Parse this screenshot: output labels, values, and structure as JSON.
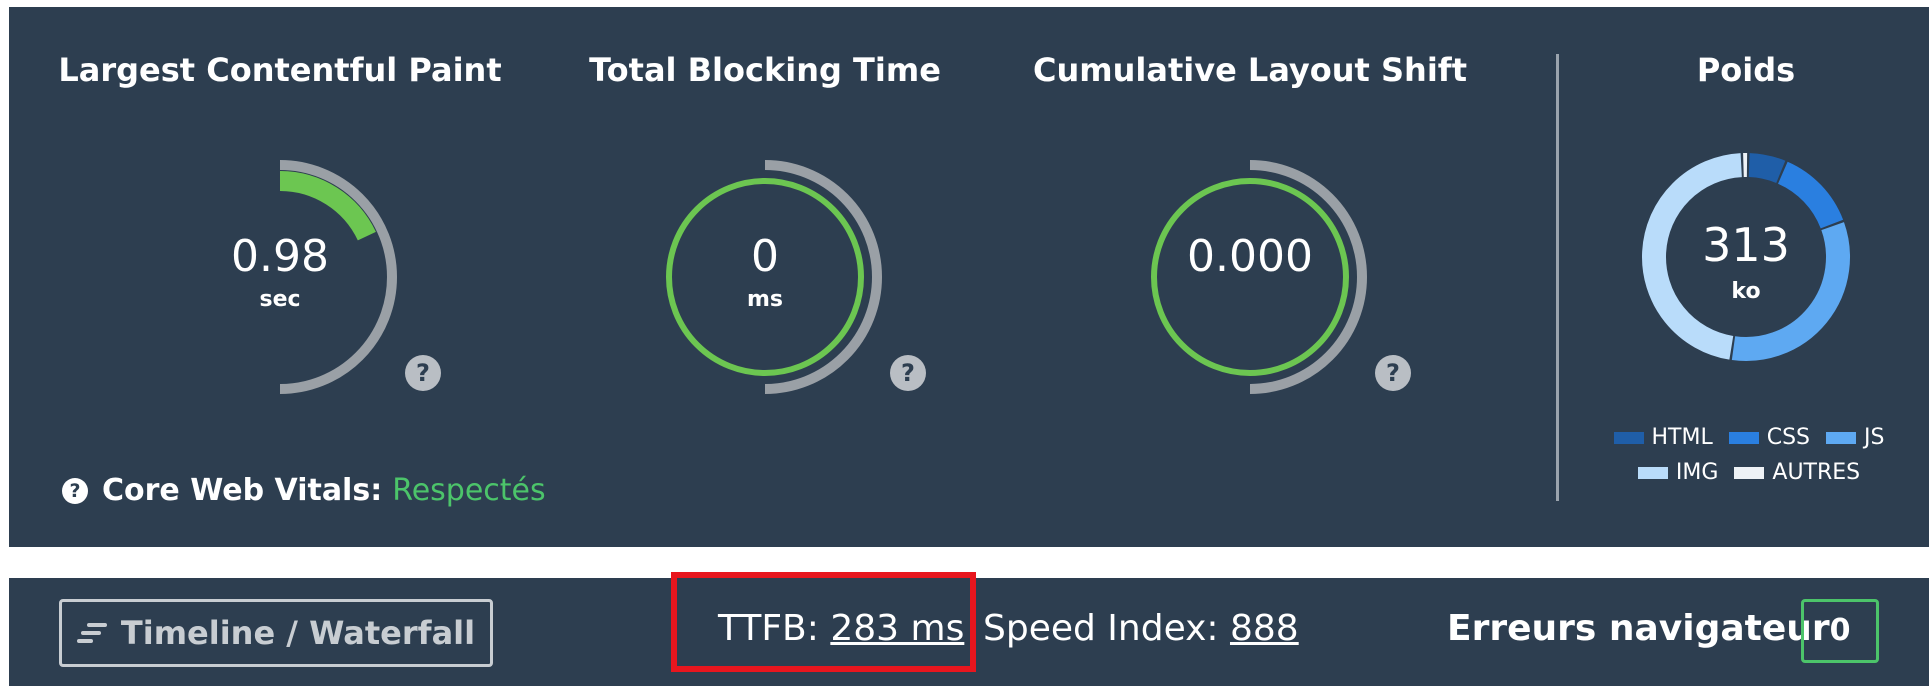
{
  "metrics": [
    {
      "title": "Largest Contentful Paint",
      "value": "0.98",
      "unit": "sec",
      "score_fraction": 0.18
    },
    {
      "title": "Total Blocking Time",
      "value": "0",
      "unit": "ms",
      "score_fraction": 1.0
    },
    {
      "title": "Cumulative Layout Shift",
      "value": "0.000",
      "unit": "",
      "score_fraction": 1.0
    }
  ],
  "help_icon": "question-circle-icon",
  "poids": {
    "title": "Poids",
    "total": "313",
    "unit": "ko",
    "legend": [
      {
        "label": "HTML",
        "color": "#1f5ea8"
      },
      {
        "label": "CSS",
        "color": "#2a7fe0"
      },
      {
        "label": "JS",
        "color": "#5ea9f2"
      },
      {
        "label": "IMG",
        "color": "#b9dcfa"
      },
      {
        "label": "AUTRES",
        "color": "#eef2f6"
      }
    ],
    "shares": [
      {
        "label": "AUTRES",
        "fraction": 0.01,
        "color": "#eef2f6"
      },
      {
        "label": "HTML",
        "fraction": 0.06,
        "color": "#1f5ea8"
      },
      {
        "label": "CSS",
        "fraction": 0.13,
        "color": "#2a7fe0"
      },
      {
        "label": "JS",
        "fraction": 0.33,
        "color": "#5ea9f2"
      },
      {
        "label": "IMG",
        "fraction": 0.47,
        "color": "#b9dcfa"
      }
    ]
  },
  "core_web_vitals": {
    "label": "Core Web Vitals:",
    "status": "Respectés"
  },
  "bottom": {
    "timeline_button": "Timeline / Waterfall",
    "ttfb_label": "TTFB:",
    "ttfb_value": "283 ms",
    "speed_index_label": "Speed Index:",
    "speed_index_value": "888",
    "errors_label": "Erreurs navigateur",
    "errors_count": "0"
  },
  "colors": {
    "panel": "#2d3e50",
    "good": "#6cc651",
    "track": "#9aa0a6",
    "highlight": "#e8161e"
  }
}
